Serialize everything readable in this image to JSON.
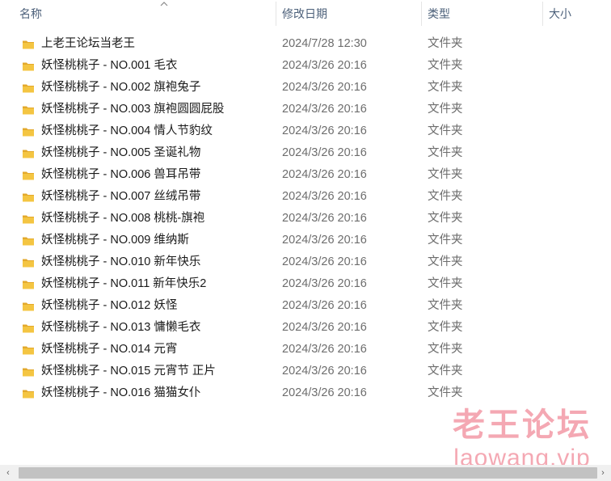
{
  "header": {
    "col_name": "名称",
    "col_date": "修改日期",
    "col_type": "类型",
    "col_size": "大小"
  },
  "rows": [
    {
      "name": "上老王论坛当老王",
      "date": "2024/7/28 12:30",
      "type": "文件夹"
    },
    {
      "name": "妖怪桃桃子 - NO.001 毛衣",
      "date": "2024/3/26 20:16",
      "type": "文件夹"
    },
    {
      "name": "妖怪桃桃子 - NO.002 旗袍兔子",
      "date": "2024/3/26 20:16",
      "type": "文件夹"
    },
    {
      "name": "妖怪桃桃子 - NO.003 旗袍圆圆屁股",
      "date": "2024/3/26 20:16",
      "type": "文件夹"
    },
    {
      "name": "妖怪桃桃子 - NO.004 情人节豹纹",
      "date": "2024/3/26 20:16",
      "type": "文件夹"
    },
    {
      "name": "妖怪桃桃子 - NO.005 圣诞礼物",
      "date": "2024/3/26 20:16",
      "type": "文件夹"
    },
    {
      "name": "妖怪桃桃子 - NO.006 兽耳吊带",
      "date": "2024/3/26 20:16",
      "type": "文件夹"
    },
    {
      "name": "妖怪桃桃子 - NO.007 丝绒吊带",
      "date": "2024/3/26 20:16",
      "type": "文件夹"
    },
    {
      "name": "妖怪桃桃子 - NO.008 桃桃-旗袍",
      "date": "2024/3/26 20:16",
      "type": "文件夹"
    },
    {
      "name": "妖怪桃桃子 - NO.009 维纳斯",
      "date": "2024/3/26 20:16",
      "type": "文件夹"
    },
    {
      "name": "妖怪桃桃子 - NO.010 新年快乐",
      "date": "2024/3/26 20:16",
      "type": "文件夹"
    },
    {
      "name": "妖怪桃桃子 - NO.011 新年快乐2",
      "date": "2024/3/26 20:16",
      "type": "文件夹"
    },
    {
      "name": "妖怪桃桃子 - NO.012 妖怪",
      "date": "2024/3/26 20:16",
      "type": "文件夹"
    },
    {
      "name": "妖怪桃桃子 - NO.013 慵懒毛衣",
      "date": "2024/3/26 20:16",
      "type": "文件夹"
    },
    {
      "name": "妖怪桃桃子 - NO.014 元宵",
      "date": "2024/3/26 20:16",
      "type": "文件夹"
    },
    {
      "name": "妖怪桃桃子 - NO.015 元宵节 正片",
      "date": "2024/3/26 20:16",
      "type": "文件夹"
    },
    {
      "name": "妖怪桃桃子 - NO.016 猫猫女仆",
      "date": "2024/3/26 20:16",
      "type": "文件夹"
    }
  ],
  "watermark": {
    "title": "老王论坛",
    "url": "laowang.vip"
  },
  "scrollbar": {
    "left_arrow": "‹",
    "right_arrow": "›"
  },
  "colors": {
    "folder": "#f4c542",
    "folder_dark": "#e3a92c",
    "watermark": "#f39aa6"
  },
  "icons": {
    "folder": "folder-icon",
    "sort": "sort-up-icon"
  }
}
